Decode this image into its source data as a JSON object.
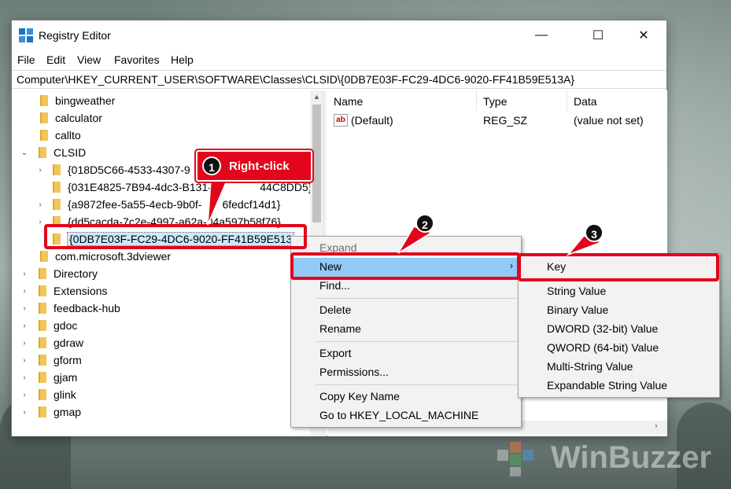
{
  "window": {
    "title": "Registry Editor",
    "minimize": "—",
    "maximize": "☐",
    "close": "✕"
  },
  "menu": [
    "File",
    "Edit",
    "View",
    "Favorites",
    "Help"
  ],
  "address": "Computer\\HKEY_CURRENT_USER\\SOFTWARE\\Classes\\CLSID\\{0DB7E03F-FC29-4DC6-9020-FF41B59E513A}",
  "tree": [
    {
      "label": "bingweather",
      "chev": ""
    },
    {
      "label": "calculator",
      "chev": ""
    },
    {
      "label": "callto",
      "chev": ""
    },
    {
      "label": "CLSID",
      "chev": "⌄"
    },
    {
      "label": "{018D5C66-4533-4307-9",
      "chev": "›"
    },
    {
      "label": "{031E4825-7B94-4dc3-B131-E",
      "chev": ""
    },
    {
      "label": "{a9872fee-5a55-4ecb-9b0f-",
      "chev": "›"
    },
    {
      "label": "{dd5cacda-7c2e-4997-a62a-04a597b58f76}",
      "chev": "›"
    },
    {
      "label": "{0DB7E03F-FC29-4DC6-9020-FF41B59E513",
      "chev": ""
    },
    {
      "label": "com.microsoft.3dviewer",
      "chev": ""
    },
    {
      "label": "Directory",
      "chev": "›"
    },
    {
      "label": "Extensions",
      "chev": "›"
    },
    {
      "label": "feedback-hub",
      "chev": "›"
    },
    {
      "label": "gdoc",
      "chev": "›"
    },
    {
      "label": "gdraw",
      "chev": "›"
    },
    {
      "label": "gform",
      "chev": "›"
    },
    {
      "label": "gjam",
      "chev": "›"
    },
    {
      "label": "glink",
      "chev": "›"
    },
    {
      "label": "gmap",
      "chev": "›"
    }
  ],
  "tree_partial": [
    "44C8DD5}",
    "6fedcf14d1}"
  ],
  "columns": [
    "Name",
    "Type",
    "Data"
  ],
  "values": [
    {
      "icon": "ab",
      "name": "(Default)",
      "type": "REG_SZ",
      "data": "(value not set)"
    }
  ],
  "context_menu": [
    "Expand",
    "New",
    "Find...",
    "Delete",
    "Rename",
    "Export",
    "Permissions...",
    "Copy Key Name",
    "Go to HKEY_LOCAL_MACHINE"
  ],
  "submenu": [
    "Key",
    "String Value",
    "Binary Value",
    "DWORD (32-bit) Value",
    "QWORD (64-bit) Value",
    "Multi-String Value",
    "Expandable String Value"
  ],
  "annotations": {
    "step1": "1",
    "step1_label": "Right-click",
    "step2": "2",
    "step3": "3"
  },
  "watermark": "WinBuzzer",
  "colors": {
    "accent_red": "#e3051b",
    "highlight": "#91c9f7",
    "selection": "#cce8ff"
  }
}
